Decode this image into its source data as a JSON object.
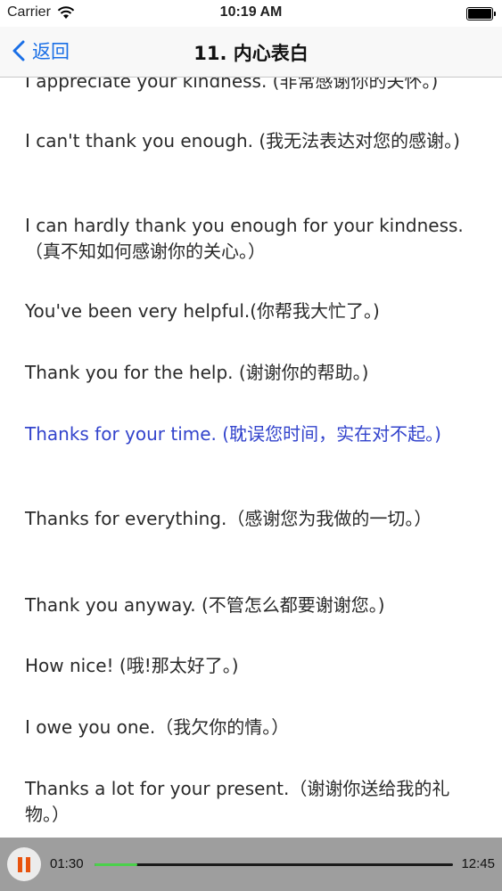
{
  "status_bar": {
    "carrier": "Carrier",
    "time": "10:19 AM"
  },
  "nav": {
    "back_label": "返回",
    "title": "11. 内心表白"
  },
  "phrases": [
    {
      "text": "I appreciate your kindness. (非常感谢你的关怀。)",
      "active": false
    },
    {
      "text": "I can't thank you enough. (我无法表达对您的感谢。)",
      "active": false
    },
    {
      "text": "I can hardly thank you enough for your kindness.（真不知如何感谢你的关心。）",
      "active": false
    },
    {
      "text": "You've been very helpful.(你帮我大忙了。)",
      "active": false
    },
    {
      "text": "Thank you for the help. (谢谢你的帮助。)",
      "active": false
    },
    {
      "text": "Thanks for your time. (耽误您时间，实在对不起。)",
      "active": true
    },
    {
      "text": "Thanks for everything.（感谢您为我做的一切。）",
      "active": false
    },
    {
      "text": "Thank you anyway. (不管怎么都要谢谢您。)",
      "active": false
    },
    {
      "text": "How nice! (哦!那太好了。)",
      "active": false
    },
    {
      "text": "I owe you one.（我欠你的情。）",
      "active": false
    },
    {
      "text": "Thanks a lot for your present.（谢谢你送给我的礼物。）",
      "active": false
    }
  ],
  "player": {
    "elapsed": "01:30",
    "total": "12:45",
    "progress": 0.12,
    "accent_color": "#4bd04b",
    "pause_icon_color": "#e8530e"
  },
  "icons": [
    "wifi-icon",
    "battery-icon",
    "back-chevron-icon",
    "pause-icon"
  ]
}
